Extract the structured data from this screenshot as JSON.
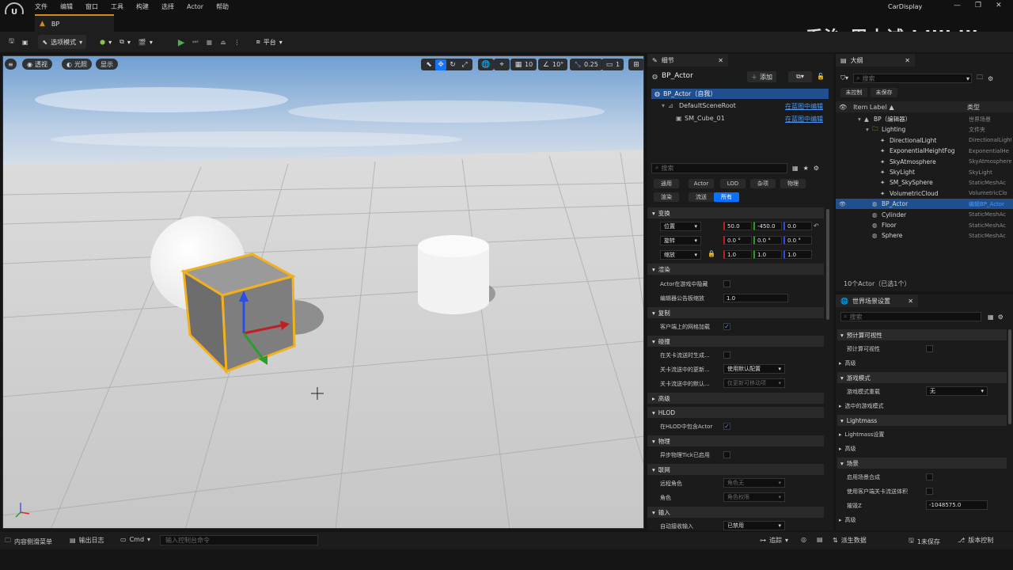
{
  "menu": [
    "文件",
    "编辑",
    "窗口",
    "工具",
    "构建",
    "选择",
    "Actor",
    "帮助"
  ],
  "tab": {
    "title": "BP"
  },
  "project": "CarDisplay",
  "watermark": "乔治-周士诚 bilibili",
  "toolbar": {
    "mode_label": "选项模式",
    "platform_label": "平台"
  },
  "viewport": {
    "perspective_label": "透视",
    "lit_label": "光照",
    "show_label": "显示",
    "grid_value": "10",
    "rotation_value": "10°",
    "scale_value": "0.25",
    "camera_speed": "1"
  },
  "details": {
    "tab_label": "细节",
    "actor_name": "BP_Actor",
    "add_label": "添加",
    "self_label": "BP_Actor（自我）",
    "components": [
      {
        "name": "DefaultSceneRoot",
        "link": "在蓝图中编辑"
      },
      {
        "name": "SM_Cube_01",
        "link": "在蓝图中编辑"
      }
    ],
    "search_placeholder": "搜索",
    "filters_row1": [
      "通用",
      "Actor",
      "LOD",
      "杂项",
      "物理"
    ],
    "filters_row2": [
      "渲染",
      "流送",
      "所有"
    ],
    "sections": {
      "transform": "变换",
      "render": "渲染",
      "replication": "复制",
      "collision": "碰撞",
      "advanced": "高级",
      "hlod": "HLOD",
      "physics": "物理",
      "networking": "联网",
      "input": "输入"
    },
    "transform": {
      "location_label": "位置",
      "location": [
        "50.0",
        "-450.0",
        "0.0"
      ],
      "rotation_label": "旋转",
      "rotation": [
        "0.0 °",
        "0.0 °",
        "0.0 °"
      ],
      "scale_label": "缩放",
      "scale": [
        "1.0",
        "1.0",
        "1.0"
      ]
    },
    "props": {
      "hidden_in_game": "Actor在游戏中隐藏",
      "billboard_scale": "编辑器公告板缩放",
      "billboard_value": "1.0",
      "net_load_client": "客户端上的网格加载",
      "gen_overlap": "在关卡流送时生成...",
      "update_overlap": "关卡流送中的更新...",
      "update_overlap_value": "使用默认配置",
      "default_update": "关卡流送中的默认...",
      "default_update_value": "仅更新可移动项",
      "include_hlod": "在HLOD中包含Actor",
      "async_tick": "异步物理Tick已启用",
      "remote_role": "远程角色",
      "remote_role_value": "角色无",
      "role": "角色",
      "role_value": "角色权限",
      "auto_input": "自动接收输入",
      "auto_input_value": "已禁用"
    }
  },
  "outliner": {
    "tab_label": "大纲",
    "search_placeholder": "搜索",
    "btn_uncontrolled": "未控制",
    "btn_unsaved": "未保存",
    "col_label": "Item Label",
    "col_type": "类型",
    "rows": [
      {
        "label": "BP（编辑器）",
        "type": "世界场景",
        "indent": 1
      },
      {
        "label": "Lighting",
        "type": "文件夹",
        "indent": 2
      },
      {
        "label": "DirectionalLight",
        "type": "DirectionalLight",
        "indent": 3
      },
      {
        "label": "ExponentialHeightFog",
        "type": "ExponentialHe",
        "indent": 3
      },
      {
        "label": "SkyAtmosphere",
        "type": "SkyAtmosphere",
        "indent": 3
      },
      {
        "label": "SkyLight",
        "type": "SkyLight",
        "indent": 3
      },
      {
        "label": "SM_SkySphere",
        "type": "StaticMeshAc",
        "indent": 3
      },
      {
        "label": "VolumetricCloud",
        "type": "VolumetricClo",
        "indent": 3
      },
      {
        "label": "BP_Actor",
        "type": "编辑BP_Actor",
        "indent": 2,
        "selected": true
      },
      {
        "label": "Cylinder",
        "type": "StaticMeshAc",
        "indent": 2
      },
      {
        "label": "Floor",
        "type": "StaticMeshAc",
        "indent": 2
      },
      {
        "label": "Sphere",
        "type": "StaticMeshAc",
        "indent": 2
      }
    ],
    "footer": "10个Actor（已选1个）"
  },
  "world": {
    "tab_label": "世界场景设置",
    "search_placeholder": "搜索",
    "rows": [
      {
        "kind": "section",
        "label": "预计算可视性"
      },
      {
        "kind": "check",
        "label": "预计算可视性"
      },
      {
        "kind": "sub",
        "label": "高级"
      },
      {
        "kind": "section",
        "label": "游戏模式"
      },
      {
        "kind": "dropdown",
        "label": "游戏模式重载",
        "value": "无"
      },
      {
        "kind": "sub",
        "label": "选中的游戏模式"
      },
      {
        "kind": "section",
        "label": "Lightmass"
      },
      {
        "kind": "sub",
        "label": "Lightmass设置"
      },
      {
        "kind": "sub",
        "label": "高级"
      },
      {
        "kind": "section",
        "label": "场景"
      },
      {
        "kind": "check",
        "label": "启用场景合成"
      },
      {
        "kind": "check",
        "label": "使用客户端关卡流送体积"
      },
      {
        "kind": "input",
        "label": "摧毁Z",
        "value": "-1048575.0"
      },
      {
        "kind": "sub",
        "label": "高级"
      }
    ]
  },
  "statusbar": {
    "content_drawer": "内容侧滑菜单",
    "output_log": "输出日志",
    "cmd": "Cmd",
    "console_placeholder": "输入控制台命令",
    "trace": "追踪",
    "derived_data": "派生数据",
    "unsaved": "1未保存",
    "source_control": "版本控制"
  },
  "colors": {
    "accent": "#0a70ff",
    "selection": "#1f4f8f",
    "tab_orange": "#d08b1a",
    "link": "#4a9aff"
  }
}
